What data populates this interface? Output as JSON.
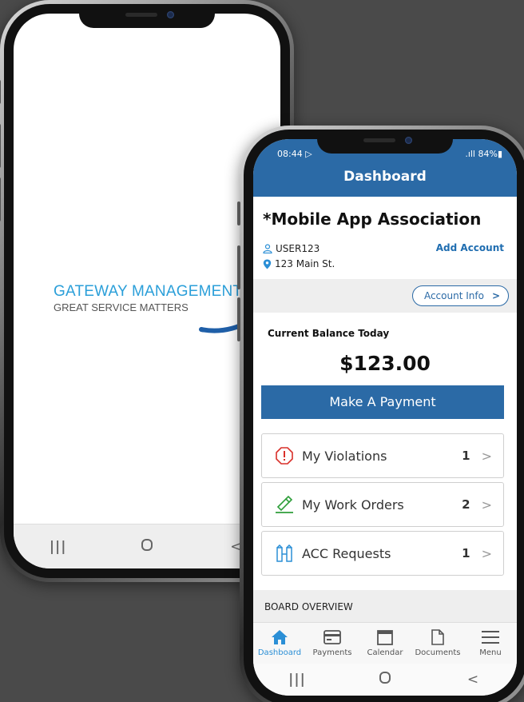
{
  "splash": {
    "logo_title": "GATEWAY MANAGEMENT",
    "logo_subtitle": "GREAT SERVICE MATTERS"
  },
  "android_nav": {
    "recents_glyph": "|||",
    "back_glyph": "<"
  },
  "status_bar": {
    "time": "08:44 ▷",
    "right": ".ıll 84%▮"
  },
  "header": {
    "title": "Dashboard"
  },
  "account": {
    "association_name": "*Mobile App Association",
    "username": "USER123",
    "address": "123 Main St.",
    "add_account_label": "Add Account",
    "account_info_label": "Account Info",
    "account_info_chevron": ">"
  },
  "balance": {
    "label": "Current Balance Today",
    "amount": "$123.00",
    "pay_button_label": "Make A Payment"
  },
  "cards": [
    {
      "label": "My Violations",
      "count": "1",
      "icon": "alert-octagon-icon",
      "chevron": ">"
    },
    {
      "label": "My Work Orders",
      "count": "2",
      "icon": "hammer-icon",
      "chevron": ">"
    },
    {
      "label": "ACC Requests",
      "count": "1",
      "icon": "building-icon",
      "chevron": ">"
    }
  ],
  "board": {
    "label": "BOARD OVERVIEW"
  },
  "tabs": [
    {
      "label": "Dashboard",
      "icon": "home-icon",
      "active": true
    },
    {
      "label": "Payments",
      "icon": "credit-card-icon",
      "active": false
    },
    {
      "label": "Calendar",
      "icon": "calendar-icon",
      "active": false
    },
    {
      "label": "Documents",
      "icon": "document-icon",
      "active": false
    },
    {
      "label": "Menu",
      "icon": "menu-icon",
      "active": false
    }
  ],
  "colors": {
    "primary": "#2b6aa6",
    "accent": "#2b8fd6",
    "violation_red": "#d9302a",
    "work_order_green": "#2e9e3a",
    "background": "#4a4a4a"
  }
}
